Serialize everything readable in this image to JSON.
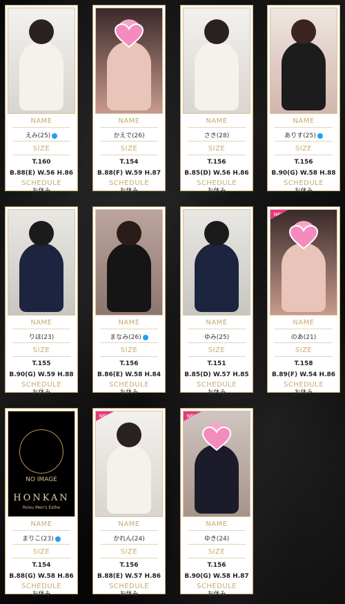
{
  "labels": {
    "name": "NAME",
    "size": "SIZE",
    "schedule": "SCHEDULE",
    "new": "NEW"
  },
  "noimage": {
    "caption": "NO IMAGE",
    "brand": "HONKAN",
    "sub": "Roisu Men's Esthe"
  },
  "cards": [
    {
      "name": "えみ(25)",
      "twitter": true,
      "height": "T.160",
      "measure": "B.88(E) W.56 H.86",
      "status": "お休み",
      "new": false,
      "noimage": false,
      "theme": "light"
    },
    {
      "name": "かえで(26)",
      "twitter": false,
      "height": "T.154",
      "measure": "B.88(F) W.59 H.87",
      "status": "お休み",
      "new": false,
      "noimage": false,
      "theme": "pink"
    },
    {
      "name": "さき(28)",
      "twitter": false,
      "height": "T.156",
      "measure": "B.85(D) W.56 H.86",
      "status": "お休み",
      "new": false,
      "noimage": false,
      "theme": "light"
    },
    {
      "name": "ありす(25)",
      "twitter": true,
      "height": "T.156",
      "measure": "B.90(G) W.58 H.88",
      "status": "お休み",
      "new": false,
      "noimage": false,
      "theme": "warm"
    },
    {
      "name": "りほ(23)",
      "twitter": false,
      "height": "T.155",
      "measure": "B.90(G) W.59 H.88",
      "status": "お休み",
      "new": false,
      "noimage": false,
      "theme": "navy"
    },
    {
      "name": "まなみ(26)",
      "twitter": true,
      "height": "T.156",
      "measure": "B.86(E) W.58 H.84",
      "status": "お休み",
      "new": false,
      "noimage": false,
      "theme": "dark"
    },
    {
      "name": "ゆみ(25)",
      "twitter": false,
      "height": "T.151",
      "measure": "B.85(D) W.57 H.85",
      "status": "お休み",
      "new": false,
      "noimage": false,
      "theme": "navy"
    },
    {
      "name": "のあ(21)",
      "twitter": false,
      "height": "T.158",
      "measure": "B.89(F) W.54 H.86",
      "status": "お休み",
      "new": true,
      "noimage": false,
      "theme": "pink"
    },
    {
      "name": "まりこ(23)",
      "twitter": true,
      "height": "T.154",
      "measure": "B.88(G) W.58 H.86",
      "status": "お休み",
      "new": false,
      "noimage": true,
      "theme": "black"
    },
    {
      "name": "かれん(24)",
      "twitter": false,
      "height": "T.156",
      "measure": "B.88(E) W.57 H.86",
      "status": "お休み",
      "new": true,
      "noimage": false,
      "theme": "light"
    },
    {
      "name": "ゆき(24)",
      "twitter": false,
      "height": "T.156",
      "measure": "B.90(G) W.58 H.87",
      "status": "お休み",
      "new": true,
      "noimage": false,
      "theme": "pinknavy"
    }
  ],
  "colors": {
    "border": "#c6a56a",
    "label": "#c9a970",
    "twitter": "#1da1f2",
    "new_badge": "#e23b7d"
  }
}
